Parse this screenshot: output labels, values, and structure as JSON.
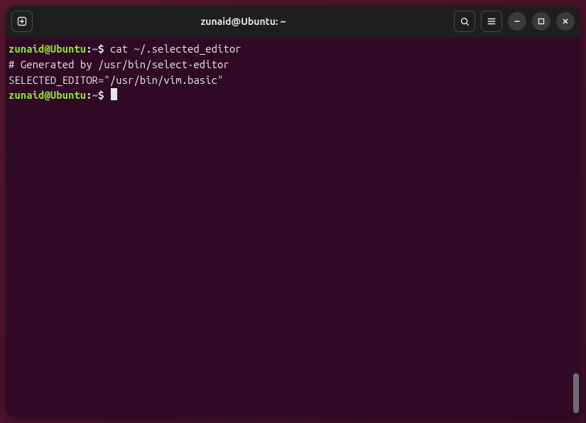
{
  "window": {
    "title": "zunaid@Ubuntu: ~"
  },
  "prompt": {
    "user_host": "zunaid@Ubuntu",
    "path": "~",
    "symbol": "$"
  },
  "lines": {
    "cmd1": "cat ~/.selected_editor",
    "out1": "# Generated by /usr/bin/select-editor",
    "out2": "SELECTED_EDITOR=\"/usr/bin/vim.basic\""
  },
  "icons": {
    "new_tab": "new-tab-icon",
    "search": "search-icon",
    "menu": "hamburger-icon",
    "minimize": "minimize-icon",
    "maximize": "maximize-icon",
    "close": "close-icon"
  }
}
